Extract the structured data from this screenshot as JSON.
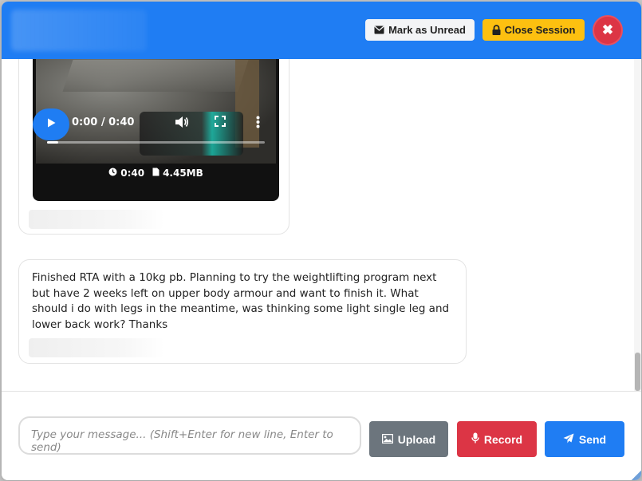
{
  "header": {
    "mark_unread_label": "Mark as Unread",
    "close_session_label": "Close Session",
    "close_button_glyph": "✖",
    "colors": {
      "bar": "#1f7df3",
      "close_session": "#fdc010",
      "close_button": "#dc3545"
    }
  },
  "messages": [
    {
      "type": "video",
      "player": {
        "time": "0:00 / 0:40",
        "duration": "0:40",
        "size": "4.45MB",
        "progress": 0.05
      }
    },
    {
      "type": "text",
      "text": "Finished RTA with a 10kg pb. Planning to try the weightlifting program next but have 2 weeks left on upper body armour and want to finish it. What should i do with legs in the meantime, was thinking some light single leg and lower back work? Thanks"
    }
  ],
  "composer": {
    "placeholder": "Type your message... (Shift+Enter for new line, Enter to send)",
    "upload_label": "Upload",
    "record_label": "Record",
    "send_label": "Send"
  },
  "icons": {
    "envelope": "envelope-icon",
    "lock": "lock-icon",
    "close": "close-icon",
    "play": "play-icon",
    "volume": "volume-icon",
    "fullscreen": "fullscreen-icon",
    "more": "more-vertical-icon",
    "clock": "clock-icon",
    "file": "file-icon",
    "image": "image-icon",
    "microphone": "microphone-icon",
    "paper_plane": "paper-plane-icon"
  }
}
